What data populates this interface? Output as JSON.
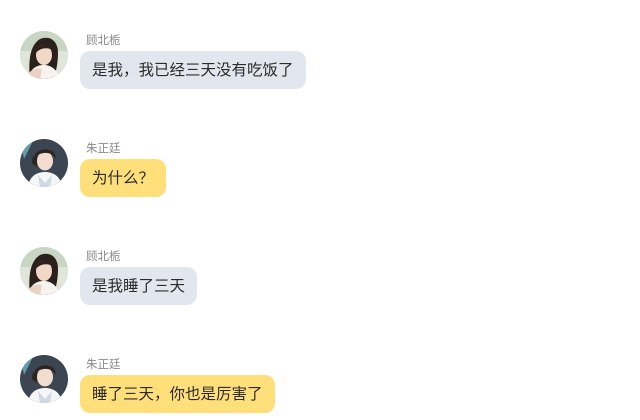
{
  "colors": {
    "bubble_gray": "#e2e7ef",
    "bubble_yellow": "#ffdf7a",
    "name_text": "#8a8a8a",
    "message_text": "#2b2b2b"
  },
  "messages": [
    {
      "sender": "顾北栀",
      "text": "是我，我已经三天没有吃饭了",
      "avatar_icon": "girl-avatar-icon",
      "bubble_color": "gray"
    },
    {
      "sender": "朱正廷",
      "text": "为什么？",
      "avatar_icon": "boy-avatar-icon",
      "bubble_color": "yellow"
    },
    {
      "sender": "顾北栀",
      "text": "是我睡了三天",
      "avatar_icon": "girl-avatar-icon",
      "bubble_color": "gray"
    },
    {
      "sender": "朱正廷",
      "text": "睡了三天，你也是厉害了",
      "avatar_icon": "boy-avatar-icon",
      "bubble_color": "yellow"
    }
  ]
}
